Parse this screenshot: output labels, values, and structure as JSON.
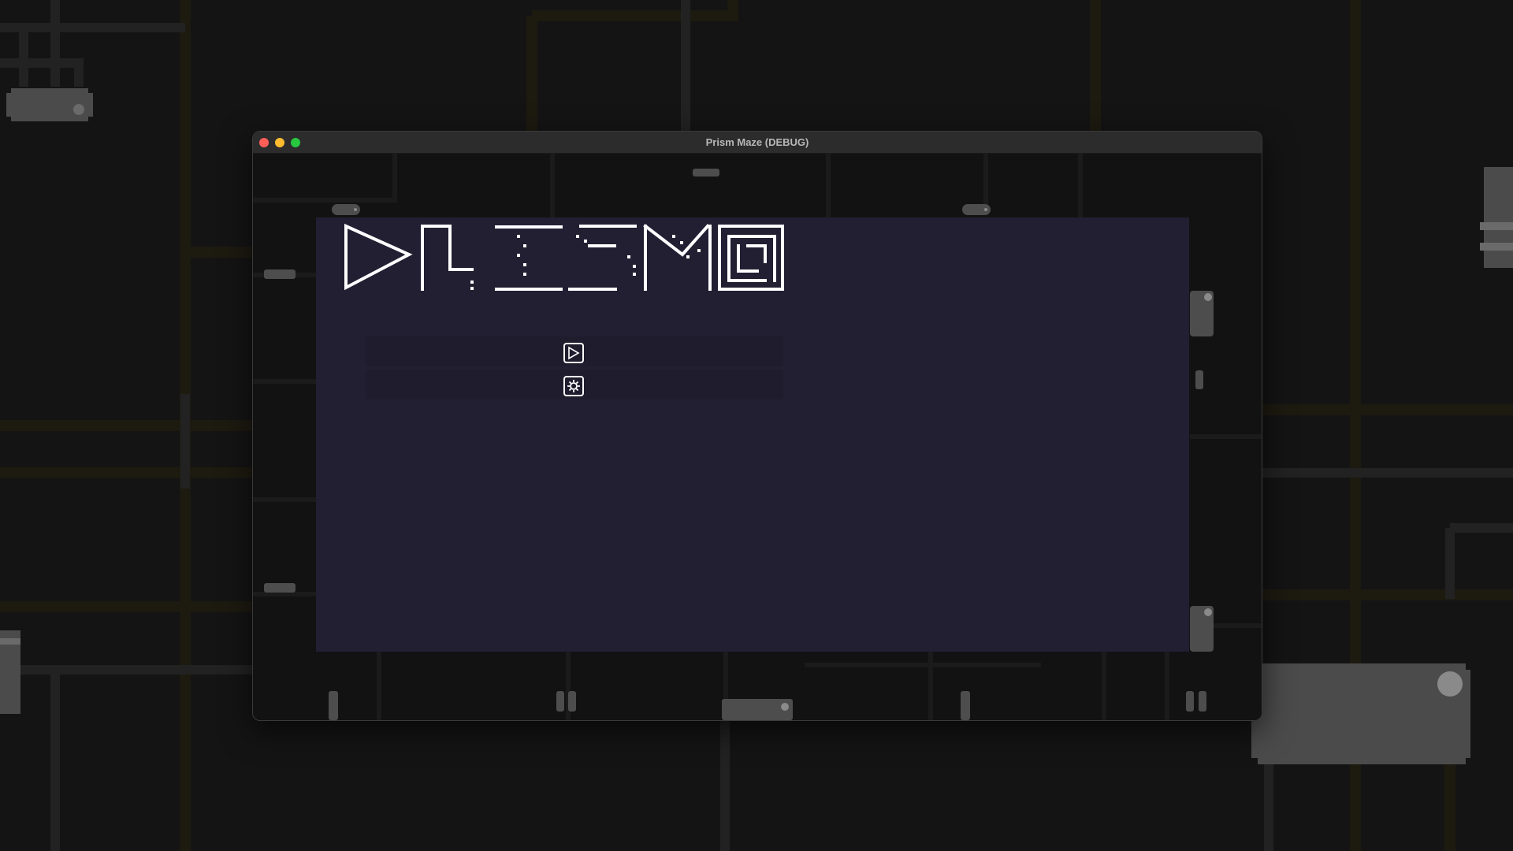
{
  "window": {
    "title": "Prism Maze (DEBUG)"
  },
  "title_logo": {
    "text": "PRISM",
    "icon": "pixel-prism-maze-logo"
  },
  "menu": {
    "items": [
      {
        "label": "",
        "icon": "play-triangle-icon"
      },
      {
        "label": "",
        "icon": "gear-settings-icon"
      }
    ]
  },
  "colors": {
    "desktop": "#141414",
    "window_bg": "#121212",
    "panel": "#221f33",
    "menu_row": "#1f1c2e",
    "pipe": "#1c1a12",
    "device": "#4a4a4a",
    "logo": "#ffffff"
  }
}
